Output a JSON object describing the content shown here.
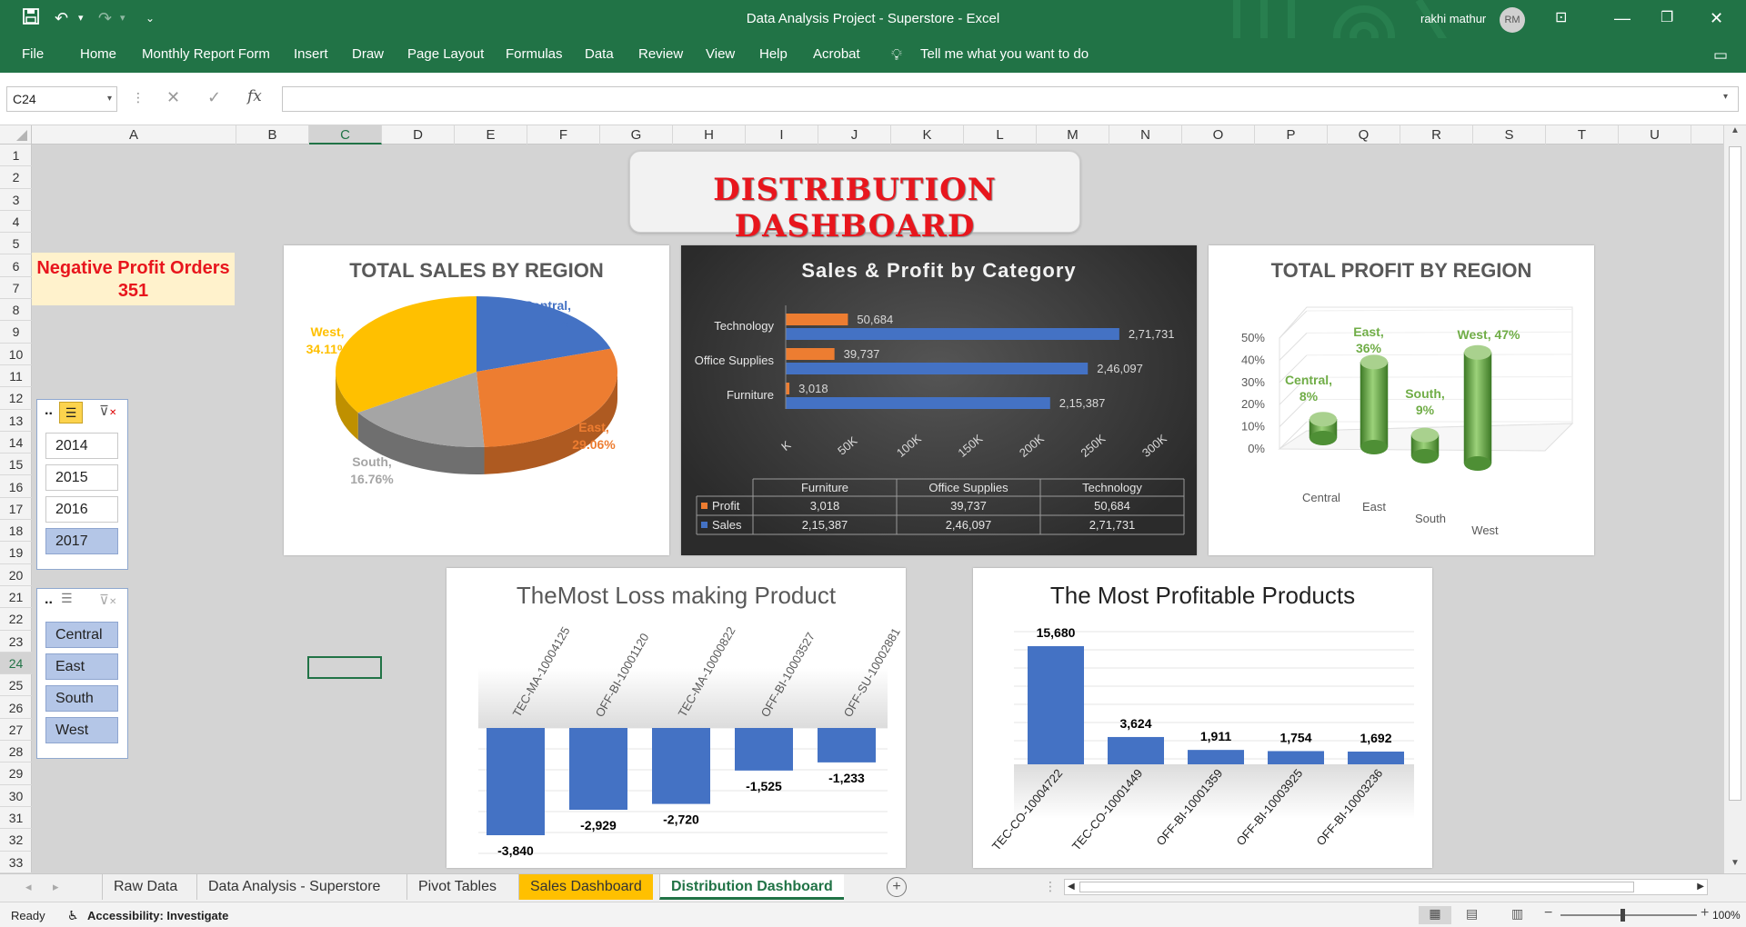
{
  "window": {
    "title": "Data Analysis Project - Superstore  -  Excel",
    "user": "rakhi mathur",
    "user_initials": "RM"
  },
  "ribbon": {
    "tabs": [
      "File",
      "Home",
      "Monthly Report Form",
      "Insert",
      "Draw",
      "Page Layout",
      "Formulas",
      "Data",
      "Review",
      "View",
      "Help",
      "Acrobat"
    ],
    "tell_me": "Tell me what you want to do"
  },
  "formula_bar": {
    "name_box": "C24",
    "fx": "fx",
    "formula": ""
  },
  "columns": [
    "A",
    "B",
    "C",
    "D",
    "E",
    "F",
    "G",
    "H",
    "I",
    "J",
    "K",
    "L",
    "M",
    "N",
    "O",
    "P",
    "Q",
    "R",
    "S",
    "T",
    "U"
  ],
  "rows": [
    "1",
    "2",
    "3",
    "4",
    "5",
    "6",
    "7",
    "8",
    "9",
    "10",
    "11",
    "12",
    "13",
    "14",
    "15",
    "16",
    "17",
    "18",
    "19",
    "20",
    "21",
    "22",
    "23",
    "24",
    "25",
    "26",
    "27",
    "28",
    "29",
    "30",
    "31",
    "32",
    "33"
  ],
  "dashboard": {
    "title": "DISTRIBUTION DASHBOARD",
    "kpi": {
      "label": "Negative Profit Orders",
      "value": "351"
    },
    "year_slicer": {
      "items": [
        "2014",
        "2015",
        "2016",
        "2017"
      ],
      "selected": [
        "2017"
      ],
      "header": ".."
    },
    "region_slicer": {
      "items": [
        "Central",
        "East",
        "South",
        "West"
      ],
      "selected": [
        "Central",
        "East",
        "South",
        "West"
      ],
      "header": ".."
    }
  },
  "chart_data": [
    {
      "type": "pie",
      "title": "TOTAL SALES BY REGION",
      "slices": [
        {
          "label": "Central",
          "value": 20.06,
          "text": "20.06%",
          "color": "#4472c4"
        },
        {
          "label": "East",
          "value": 29.06,
          "text": "29.06%",
          "color": "#ed7d31"
        },
        {
          "label": "South",
          "value": 16.76,
          "text": "16.76%",
          "color": "#a5a5a5"
        },
        {
          "label": "West",
          "value": 34.11,
          "text": "34.11%",
          "color": "#ffc000"
        }
      ]
    },
    {
      "type": "bar",
      "title": "Sales & Profit by Category",
      "categories": [
        "Furniture",
        "Office Supplies",
        "Technology"
      ],
      "series": [
        {
          "name": "Profit",
          "values": [
            3018,
            39737,
            50684
          ],
          "labels": [
            "3,018",
            "39,737",
            "50,684"
          ],
          "color": "#ed7d31"
        },
        {
          "name": "Sales",
          "values": [
            215387,
            246097,
            271731
          ],
          "labels": [
            "2,15,387",
            "2,46,097",
            "2,71,731"
          ],
          "color": "#4472c4"
        }
      ],
      "xlim": [
        0,
        300000
      ],
      "xticks": [
        "K",
        "50K",
        "100K",
        "150K",
        "200K",
        "250K",
        "300K"
      ]
    },
    {
      "type": "bar",
      "title": "TOTAL PROFIT BY REGION",
      "categories": [
        "Central",
        "East",
        "South",
        "West"
      ],
      "values": [
        8,
        36,
        9,
        47
      ],
      "data_labels": [
        "Central, 8%",
        "East, 36%",
        "South, 9%",
        "West, 47%"
      ],
      "ylim": [
        0,
        50
      ],
      "yticks": [
        "0%",
        "10%",
        "20%",
        "30%",
        "40%",
        "50%"
      ],
      "color": "#70ad47"
    },
    {
      "type": "bar",
      "title": "TheMost Loss making Product",
      "categories": [
        "TEC-MA-10004125",
        "OFF-BI-10001120",
        "TEC-MA-10000822",
        "OFF-BI-10003527",
        "OFF-SU-10002881"
      ],
      "values": [
        -3840,
        -2929,
        -2720,
        -1525,
        -1233
      ],
      "labels": [
        "-3,840",
        "-2,929",
        "-2,720",
        "-1,525",
        "-1,233"
      ],
      "color": "#4472c4"
    },
    {
      "type": "bar",
      "title": "The Most Profitable Products",
      "categories": [
        "TEC-CO-10004722",
        "TEC-CO-10001449",
        "OFF-BI-10001359",
        "OFF-BI-10003925",
        "OFF-BI-10003236"
      ],
      "values": [
        15680,
        3624,
        1911,
        1754,
        1692
      ],
      "labels": [
        "15,680",
        "3,624",
        "1,911",
        "1,754",
        "1,692"
      ],
      "color": "#4472c4"
    }
  ],
  "sheets": [
    {
      "name": "Raw Data",
      "style": "normal"
    },
    {
      "name": "Data Analysis - Superstore",
      "style": "normal"
    },
    {
      "name": "Pivot Tables",
      "style": "normal"
    },
    {
      "name": "Sales Dashboard",
      "style": "yellow"
    },
    {
      "name": "Distribution Dashboard",
      "style": "active"
    }
  ],
  "status": {
    "ready": "Ready",
    "accessibility": "Accessibility: Investigate",
    "zoom": "100%"
  },
  "colors": {
    "excel_green": "#217346",
    "title_red": "#e8161d",
    "kpi_bg": "#fff2cc"
  }
}
